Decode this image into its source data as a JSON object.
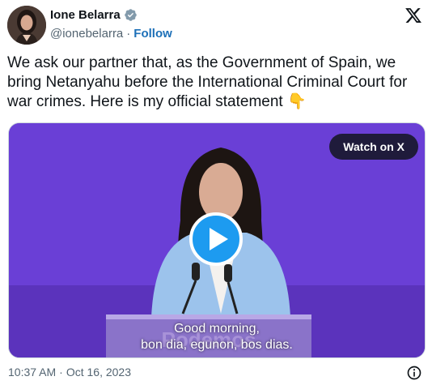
{
  "author": {
    "name": "Ione Belarra",
    "handle": "@ionebelarra",
    "separator": "·",
    "follow_label": "Follow",
    "verified_color": "#829aab"
  },
  "brand": {
    "icon": "x-logo-icon"
  },
  "tweet": {
    "text": "We ask our partner that, as the Government of Spain, we bring Netanyahu before the International Criminal Court for war crimes. Here is my official statement 👇"
  },
  "media": {
    "watch_label": "Watch on X",
    "background_color": "#6a3fd6",
    "subtitle_line1": "Good morning,",
    "subtitle_line2": "bon dia, egunon, bos dias.",
    "podium_text": "Podemos"
  },
  "footer": {
    "time": "10:37 AM",
    "separator": "·",
    "date": "Oct 16, 2023"
  },
  "accent": {
    "play_button": "#1d9bf0",
    "link": "#1d70b8"
  }
}
